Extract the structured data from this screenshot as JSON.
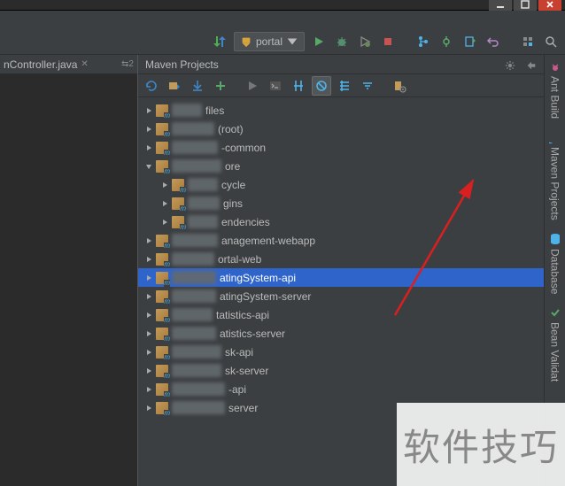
{
  "editor": {
    "tab_name": "nController.java",
    "right_indicator": "⇆2"
  },
  "toolbar": {
    "config_label": "portal"
  },
  "panel": {
    "title": "Maven Projects"
  },
  "tree": [
    {
      "depth": 0,
      "expanded": false,
      "label_suffix": "files",
      "redact_w": 34
    },
    {
      "depth": 0,
      "expanded": false,
      "label_suffix": "(root)",
      "redact_w": 48
    },
    {
      "depth": 0,
      "expanded": false,
      "label_suffix": "-common",
      "redact_w": 52
    },
    {
      "depth": 0,
      "expanded": true,
      "label_suffix": "ore",
      "redact_w": 56
    },
    {
      "depth": 1,
      "expanded": false,
      "label_suffix": "cycle",
      "redact_w": 34
    },
    {
      "depth": 1,
      "expanded": false,
      "label_suffix": "gins",
      "redact_w": 36
    },
    {
      "depth": 1,
      "expanded": false,
      "label_suffix": "endencies",
      "redact_w": 34
    },
    {
      "depth": 0,
      "expanded": false,
      "label_suffix": "anagement-webapp",
      "redact_w": 52
    },
    {
      "depth": 0,
      "expanded": false,
      "label_suffix": "ortal-web",
      "redact_w": 48
    },
    {
      "depth": 0,
      "expanded": false,
      "label_suffix": "atingSystem-api",
      "redact_w": 50,
      "selected": true
    },
    {
      "depth": 0,
      "expanded": false,
      "label_suffix": "atingSystem-server",
      "redact_w": 50
    },
    {
      "depth": 0,
      "expanded": false,
      "label_suffix": "tatistics-api",
      "redact_w": 46
    },
    {
      "depth": 0,
      "expanded": false,
      "label_suffix": "atistics-server",
      "redact_w": 50
    },
    {
      "depth": 0,
      "expanded": false,
      "label_suffix": "sk-api",
      "redact_w": 56
    },
    {
      "depth": 0,
      "expanded": false,
      "label_suffix": "sk-server",
      "redact_w": 56
    },
    {
      "depth": 0,
      "expanded": false,
      "label_suffix": "-api",
      "redact_w": 60
    },
    {
      "depth": 0,
      "expanded": false,
      "label_suffix": "server",
      "redact_w": 60
    }
  ],
  "rail": {
    "ant": "Ant Build",
    "maven": "Maven Projects",
    "database": "Database",
    "bean": "Bean Validat"
  },
  "watermark": "软件技巧"
}
